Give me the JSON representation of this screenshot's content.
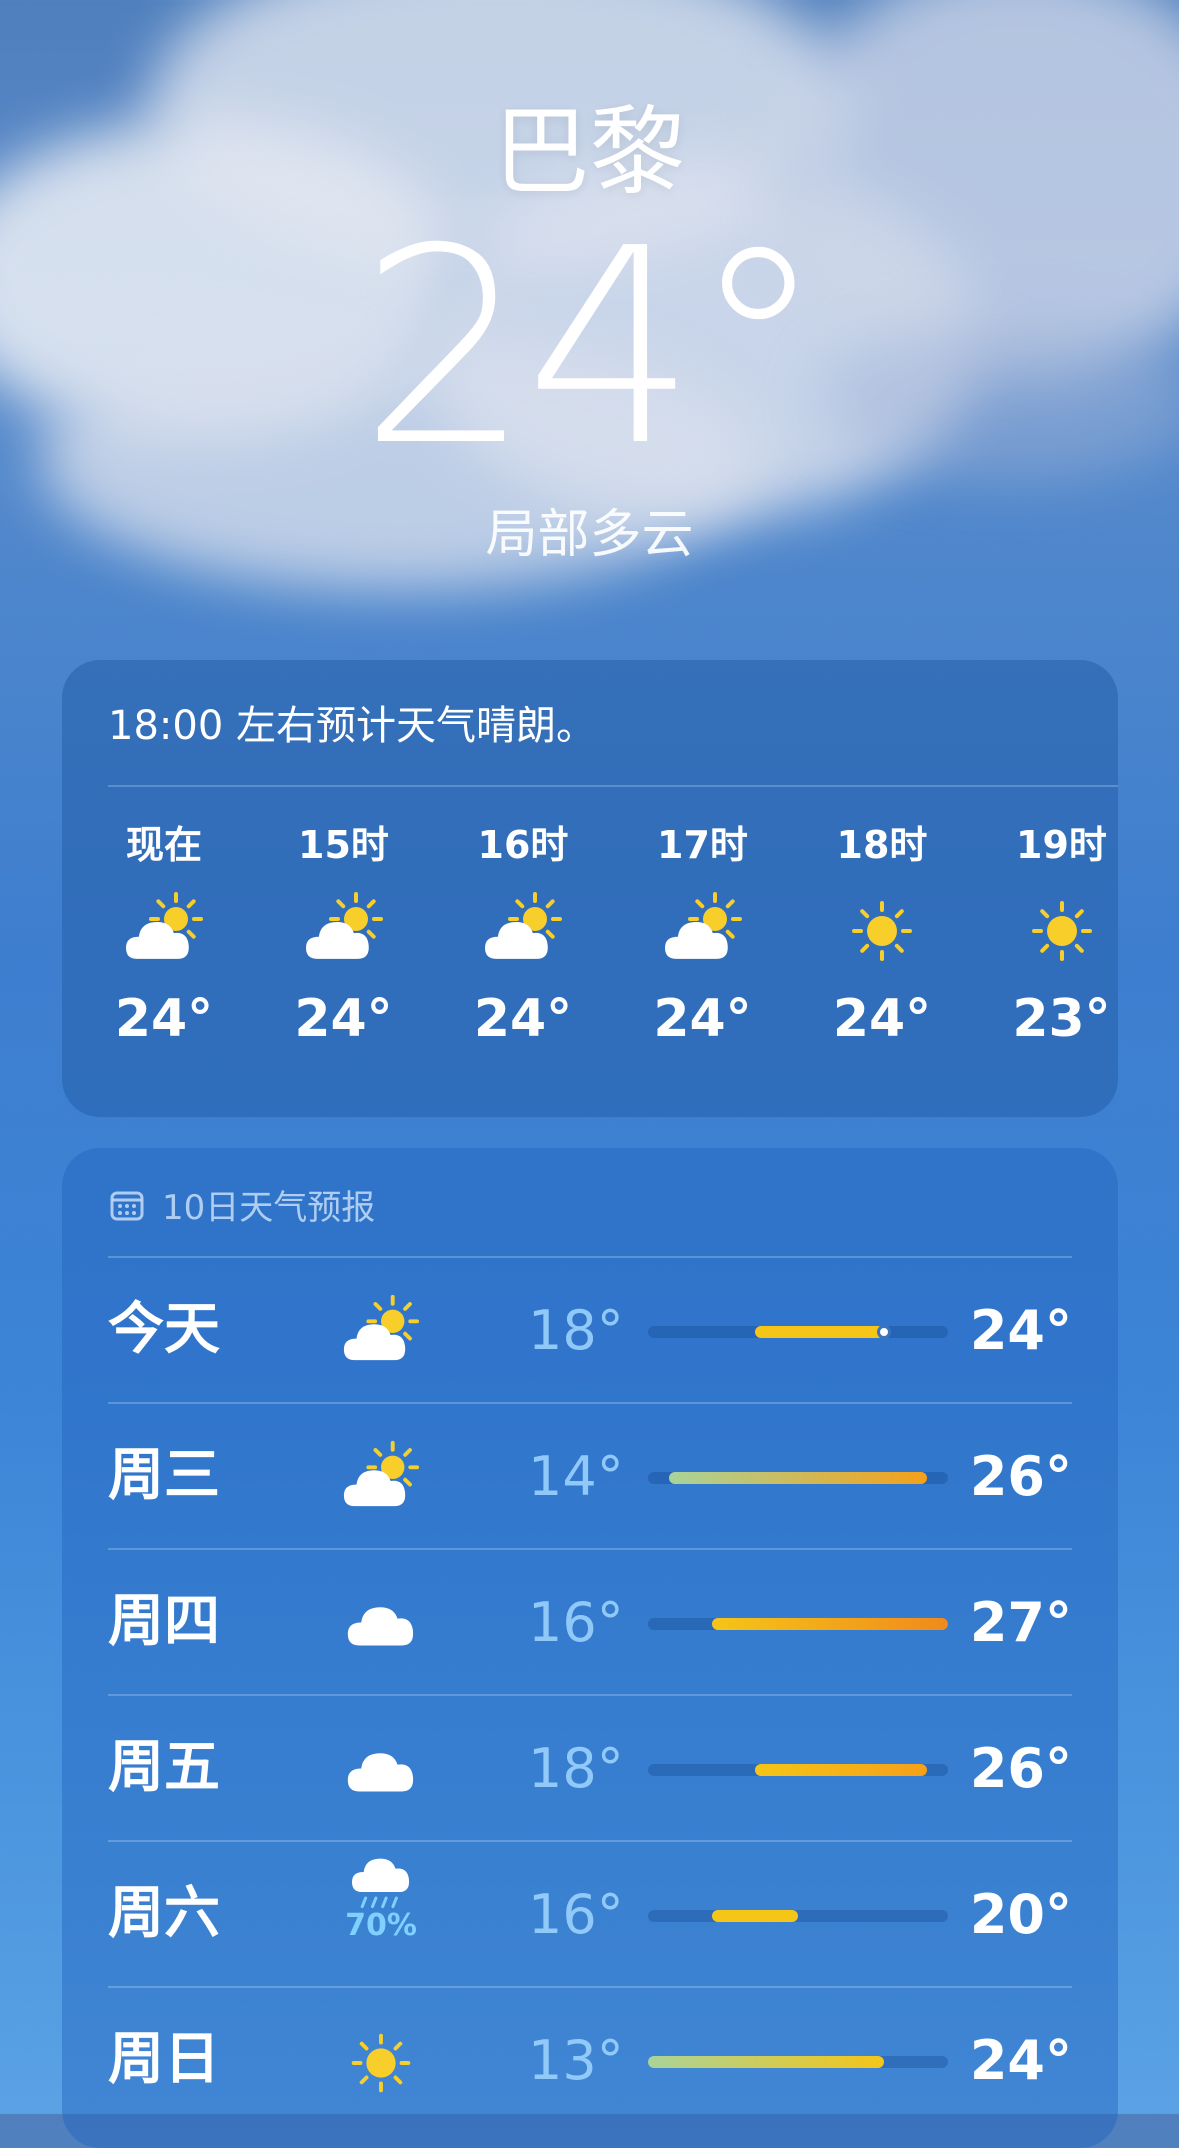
{
  "location": {
    "city": "巴黎",
    "temperature": "24°",
    "condition": "局部多云"
  },
  "hourly": {
    "summary": "18:00 左右预计天气晴朗。",
    "items": [
      {
        "label": "现在",
        "icon": "partly-cloudy-icon",
        "temp": "24°"
      },
      {
        "label": "15时",
        "icon": "partly-cloudy-icon",
        "temp": "24°"
      },
      {
        "label": "16时",
        "icon": "partly-cloudy-icon",
        "temp": "24°"
      },
      {
        "label": "17时",
        "icon": "partly-cloudy-icon",
        "temp": "24°"
      },
      {
        "label": "18时",
        "icon": "sun-icon",
        "temp": "24°"
      },
      {
        "label": "19时",
        "icon": "sun-icon",
        "temp": "23°"
      }
    ]
  },
  "daily": {
    "title": "10日天气预报",
    "range_min": 13,
    "range_max": 27,
    "colors": {
      "cool": "#a9d39a",
      "mild": "#f5c518",
      "warm": "#f5a019",
      "hot": "#f08a1c"
    },
    "items": [
      {
        "day": "今天",
        "icon": "partly-cloudy-icon",
        "low": "18°",
        "high": "24°",
        "low_v": 18,
        "high_v": 24,
        "current_v": 24,
        "popup": ""
      },
      {
        "day": "周三",
        "icon": "partly-cloudy-icon",
        "low": "14°",
        "high": "26°",
        "low_v": 14,
        "high_v": 26,
        "popup": ""
      },
      {
        "day": "周四",
        "icon": "cloud-icon",
        "low": "16°",
        "high": "27°",
        "low_v": 16,
        "high_v": 27,
        "popup": ""
      },
      {
        "day": "周五",
        "icon": "cloud-icon",
        "low": "18°",
        "high": "26°",
        "low_v": 18,
        "high_v": 26,
        "popup": ""
      },
      {
        "day": "周六",
        "icon": "rain-icon",
        "low": "16°",
        "high": "20°",
        "low_v": 16,
        "high_v": 20,
        "popup": "70%"
      },
      {
        "day": "周日",
        "icon": "sun-icon",
        "low": "13°",
        "high": "24°",
        "low_v": 13,
        "high_v": 24,
        "popup": ""
      }
    ]
  }
}
